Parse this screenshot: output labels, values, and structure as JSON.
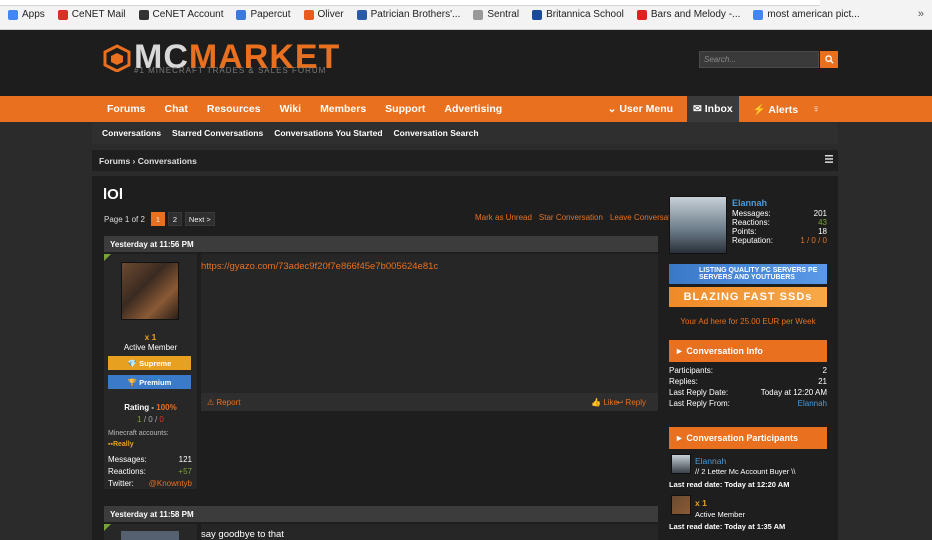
{
  "bookmarks": {
    "items": [
      {
        "label": "Apps",
        "color": "#4285f4"
      },
      {
        "label": "CeNET Mail",
        "color": "#d93025"
      },
      {
        "label": "CeNET Account",
        "color": "#333333"
      },
      {
        "label": "Papercut",
        "color": "#3b7ad8"
      },
      {
        "label": "Oliver",
        "color": "#e85a1e"
      },
      {
        "label": "Patrician Brothers'...",
        "color": "#2a5ba8"
      },
      {
        "label": "Sentral",
        "color": "#999999"
      },
      {
        "label": "Britannica School",
        "color": "#1a4a9a"
      },
      {
        "label": "Bars and Melody -...",
        "color": "#e02020"
      },
      {
        "label": "most american pict...",
        "color": "#4285f4"
      }
    ],
    "more": "»"
  },
  "header": {
    "logo_mc": "MC",
    "logo_market": "MARKET",
    "logo_sub": "#1 MINECRAFT TRADES & SALES FORUM",
    "search_placeholder": "Search..."
  },
  "nav": {
    "items": [
      "Forums",
      "Chat",
      "Resources",
      "Wiki",
      "Members",
      "Support",
      "Advertising"
    ],
    "user_menu": "User Menu",
    "inbox": "Inbox",
    "alerts": "Alerts"
  },
  "subnav": [
    "Conversations",
    "Starred Conversations",
    "Conversations You Started",
    "Conversation Search"
  ],
  "breadcrumb": {
    "root": "Forums",
    "current": "Conversations"
  },
  "thread": {
    "title": "lOl",
    "page_label": "Page 1 of 2",
    "pages": [
      "1",
      "2"
    ],
    "next": "Next >",
    "actions": [
      "Mark as Unread",
      "Star Conversation",
      "Leave Conversation"
    ]
  },
  "message1": {
    "date": "Yesterday at 11:56 PM",
    "link": "https://gyazo.com/73adec9f20f7e866f45e7b005624e81c",
    "report": "Report",
    "like": "Like",
    "reply": "Reply",
    "user": {
      "name": "x 1",
      "title": "Active Member",
      "badge1": "Supreme",
      "badge2": "Premium",
      "rating_label": "Rating - ",
      "rating_value": "100%",
      "r1": "1",
      "r2": "0",
      "r3": "0",
      "mc_accounts": "Minecraft accounts:",
      "really": "Really",
      "messages_label": "Messages:",
      "messages": "121",
      "reactions_label": "Reactions:",
      "reactions": "+57",
      "twitter_label": "Twitter:",
      "twitter": "@Knowntyb"
    }
  },
  "message2": {
    "date": "Yesterday at 11:58 PM",
    "text": "say goodbye to that"
  },
  "sidebar": {
    "name": "Elannah",
    "stats": [
      {
        "label": "Messages:",
        "value": "201"
      },
      {
        "label": "Reactions:",
        "value": "43"
      },
      {
        "label": "Points:",
        "value": "18"
      },
      {
        "label": "Reputation:",
        "value": "1 / 0 / 0"
      }
    ],
    "ad1": "LISTING QUALITY PC SERVERS PE SERVERS AND YOUTUBERS",
    "ad2": "BLAZING FAST SSDs",
    "ad_text": "Your Ad here for 25.00 EUR per Week",
    "info_title": "Conversation Info",
    "info": [
      {
        "label": "Participants:",
        "value": "2"
      },
      {
        "label": "Replies:",
        "value": "21"
      },
      {
        "label": "Last Reply Date:",
        "value": "Today at 12:20 AM"
      },
      {
        "label": "Last Reply From:",
        "value": "Elannah"
      }
    ],
    "participants_title": "Conversation Participants",
    "p1": {
      "name": "Elannah",
      "title": "// 2 Letter Mc Account Buyer \\\\",
      "read": "Last read date: Today at 12:20 AM"
    },
    "p2": {
      "name": "x 1",
      "title": "Active Member",
      "read": "Last read date: Today at 1:35 AM"
    }
  }
}
